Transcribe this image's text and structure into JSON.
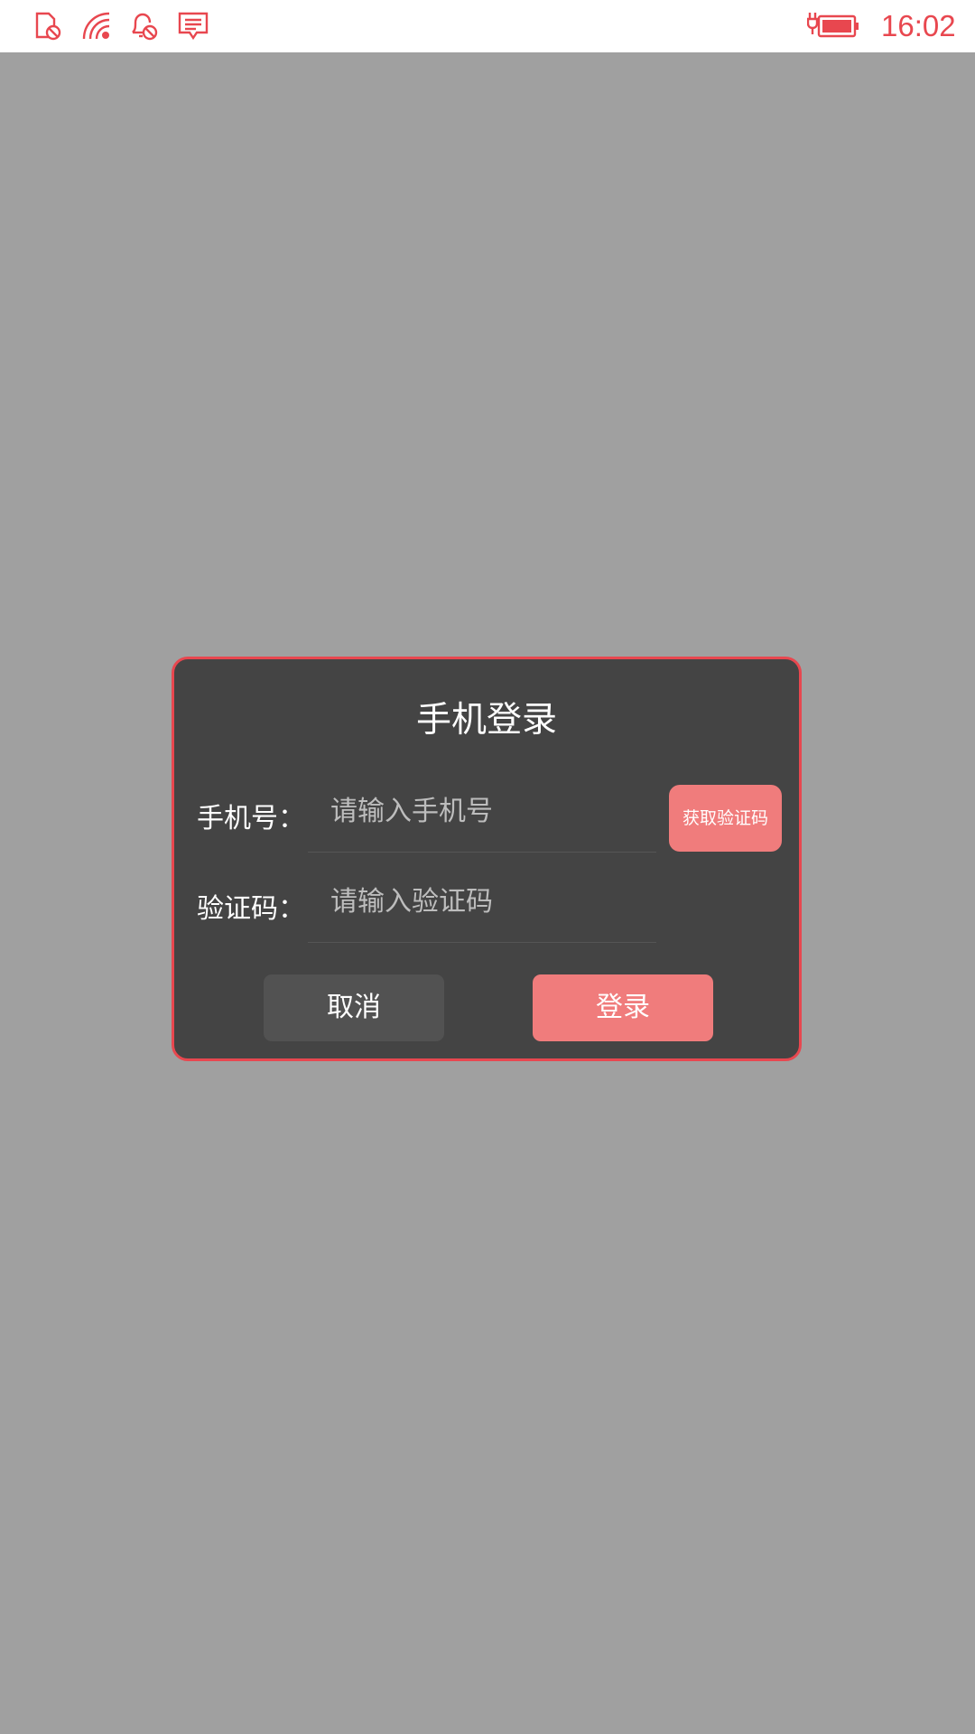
{
  "status_bar": {
    "icons": [
      "sim-blocked-icon",
      "wifi-signal-icon",
      "notification-blocked-icon",
      "message-icon",
      "battery-charging-icon"
    ],
    "time": "16:02",
    "accent_color": "#e8474f"
  },
  "dialog": {
    "title": "手机登录",
    "phone": {
      "label": "手机号：",
      "placeholder": "请输入手机号",
      "value": ""
    },
    "code": {
      "label": "验证码：",
      "placeholder": "请输入验证码",
      "value": ""
    },
    "get_code_label": "获取验证码",
    "cancel_label": "取消",
    "login_label": "登录",
    "colors": {
      "background": "#444444",
      "border": "#e8474f",
      "primary_button": "#f07c7c",
      "secondary_button": "#525252"
    }
  },
  "overlay_color": "#a0a0a0"
}
